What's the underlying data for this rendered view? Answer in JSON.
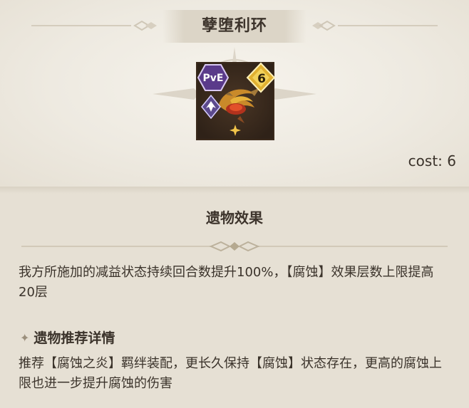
{
  "relic": {
    "name": "孽堕利环",
    "mode_badge": "PvE",
    "level": "6",
    "cost_label": "cost:  6"
  },
  "effect": {
    "heading": "遗物效果",
    "description": "我方所施加的减益状态持续回合数提升100%，【腐蚀】效果层数上限提高20层"
  },
  "recommendation": {
    "heading": "遗物推荐详情",
    "description": "推荐【腐蚀之炎】羁绊装配，更长久保持【腐蚀】状态存在，更高的腐蚀上限也进一步提升腐蚀的伤害"
  },
  "colors": {
    "background": "#e8e2d6",
    "text": "#3b332b",
    "badge_purple": "#5a3a8a",
    "badge_gold": "#e0b030"
  },
  "icons": [
    "compass-decoration-icon",
    "pve-badge-icon",
    "level-diamond-icon",
    "relic-ring-icon",
    "faction-emblem-icon",
    "sparkle-icon",
    "star-bullet-icon"
  ]
}
